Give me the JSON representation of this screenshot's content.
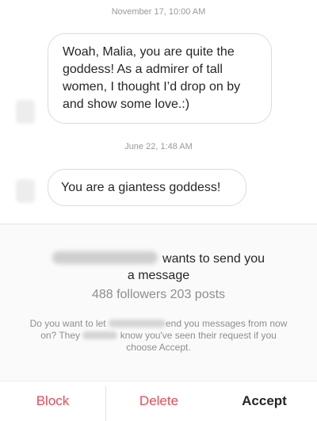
{
  "thread": {
    "timestamp_1": "November 17, 10:00 AM",
    "message_1": "Woah, Malia, you are quite the goddess! As a admirer of tall women, I thought I’d drop on by and show some love.:)",
    "timestamp_2": "June 22, 1:48 AM",
    "message_2": "You are a giantess goddess!"
  },
  "request": {
    "wants_text": "wants to send you",
    "wants_text_2": "a message",
    "stats": "488 followers 203 posts",
    "prompt_part_1": "Do you want to let",
    "prompt_part_2": "end you messages from now on? They",
    "prompt_part_3": "know you've seen their request if you choose Accept."
  },
  "actions": {
    "block_label": "Block",
    "delete_label": "Delete",
    "accept_label": "Accept"
  },
  "colors": {
    "destructive": "#ed4956",
    "primary_text": "#262626",
    "secondary_text": "#8e8e8e",
    "panel_background": "#fafafa"
  }
}
